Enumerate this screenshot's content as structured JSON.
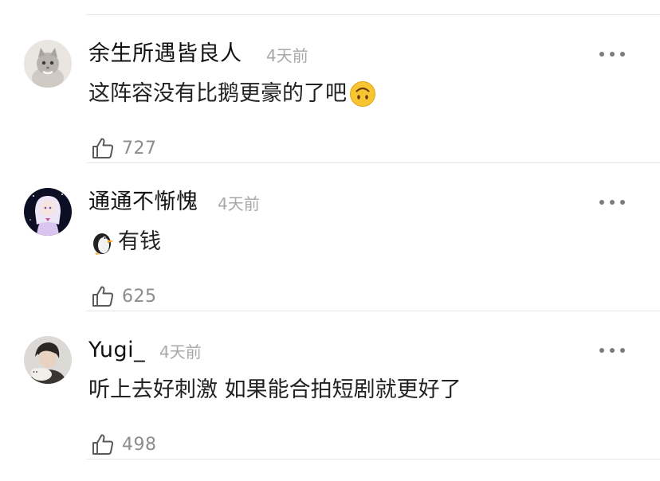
{
  "comments": [
    {
      "username": "余生所遇皆良人",
      "time": "4天前",
      "text": "这阵容没有比鹅更豪的了吧",
      "emoji": "upside-down-face-emoji",
      "likes": "727",
      "avatar": "cat-avatar"
    },
    {
      "username": "通通不惭愧",
      "time": "4天前",
      "text": "有钱",
      "emoji": "penguin-emoji",
      "likes": "625",
      "avatar": "anime-girl-avatar"
    },
    {
      "username": "Yugi_",
      "time": "4天前",
      "text": "听上去好刺激 如果能合拍短剧就更好了",
      "likes": "498",
      "avatar": "person-with-cat-avatar"
    }
  ],
  "icons": {
    "like": "thumbs-up-icon",
    "more": "more-dots-icon"
  },
  "colors": {
    "username": "#111111",
    "time": "#a8a8a8",
    "text": "#222222",
    "likes": "#8c8c8c",
    "divider": "#e6e6e6"
  }
}
